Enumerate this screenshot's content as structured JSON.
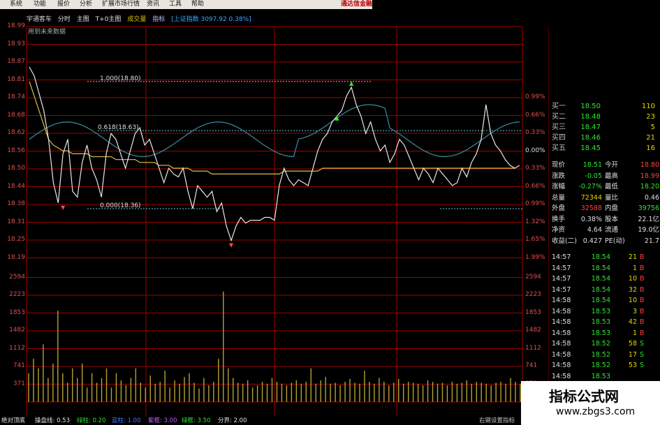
{
  "menu": [
    "系统",
    "功能",
    "报价",
    "分析",
    "扩展市场行情",
    "资讯",
    "工具",
    "帮助"
  ],
  "brand": "通达信金融",
  "header": {
    "name": "宇通客车",
    "tabs": [
      "分时",
      "主图",
      "T+0主图"
    ],
    "volume": "成交量",
    "indicator": "指标",
    "index": "[上证指数 3097.92 0.38%]"
  },
  "future_label": "用到未来数据",
  "price_axis_left": [
    "18.99",
    "18.93",
    "18.87",
    "18.81",
    "18.74",
    "18.68",
    "18.62",
    "18.56",
    "18.50",
    "18.44",
    "18.38",
    "18.31",
    "18.25",
    "18.19"
  ],
  "price_axis_right": [
    "",
    "",
    "",
    "",
    "0.99%",
    "0.66%",
    "0.33%",
    "0.00%",
    "0.33%",
    "0.66%",
    "0.99%",
    "1.32%",
    "1.65%",
    "1.99%"
  ],
  "volume_axis": [
    "2594",
    "2223",
    "1853",
    "1482",
    "1112",
    "741",
    "371"
  ],
  "fib_levels": [
    {
      "label": "1.000(18.80)",
      "price": 18.8
    },
    {
      "label": "0.618(18.63)",
      "price": 18.63
    },
    {
      "label": "0.000(18.36)",
      "price": 18.36
    }
  ],
  "colors": {
    "grid": "#a00000",
    "price_line": "#e8e8e8",
    "avg_line": "#c8b040",
    "index_line": "#3d8ca0",
    "fib_line": "#4fb8c8",
    "volume_bar": "#b8a030"
  },
  "quotes": [
    {
      "label": "买一",
      "price": "18.50",
      "volume": "110"
    },
    {
      "label": "买二",
      "price": "18.48",
      "volume": "23"
    },
    {
      "label": "买三",
      "price": "18.47",
      "volume": "5"
    },
    {
      "label": "买四",
      "price": "18.46",
      "volume": "21"
    },
    {
      "label": "买五",
      "price": "18.45",
      "volume": "16"
    }
  ],
  "stats": [
    {
      "l1": "现价",
      "v1": "18.51",
      "l2": "今开",
      "v2": "18.80"
    },
    {
      "l1": "涨跌",
      "v1": "-0.05",
      "l2": "最高",
      "v2": "18.99"
    },
    {
      "l1": "涨幅",
      "v1": "-0.27%",
      "l2": "最低",
      "v2": "18.20"
    },
    {
      "l1": "总量",
      "v1": "72344",
      "l2": "量比",
      "v2": "0.46"
    },
    {
      "l1": "外盘",
      "v1": "32588",
      "l2": "内盘",
      "v2": "39756"
    },
    {
      "l1": "换手",
      "v1": "0.38%",
      "l2": "股本",
      "v2": "22.1亿"
    },
    {
      "l1": "净资",
      "v1": "4.64",
      "l2": "流通",
      "v2": "19.0亿"
    },
    {
      "l1": "收益(二)",
      "v1": "0.427",
      "l2": "PE(动)",
      "v2": "21.7"
    }
  ],
  "ticks": [
    {
      "time": "14:57",
      "price": "18.54",
      "vol": "21",
      "side": "B"
    },
    {
      "time": "14:57",
      "price": "18.54",
      "vol": "1",
      "side": "B"
    },
    {
      "time": "14:57",
      "price": "18.54",
      "vol": "10",
      "side": "B"
    },
    {
      "time": "14:57",
      "price": "18.54",
      "vol": "32",
      "side": "B"
    },
    {
      "time": "14:58",
      "price": "18.54",
      "vol": "10",
      "side": "B"
    },
    {
      "time": "14:58",
      "price": "18.53",
      "vol": "3",
      "side": "B"
    },
    {
      "time": "14:58",
      "price": "18.53",
      "vol": "42",
      "side": "B"
    },
    {
      "time": "14:58",
      "price": "18.53",
      "vol": "1",
      "side": "B"
    },
    {
      "time": "14:58",
      "price": "18.52",
      "vol": "58",
      "side": "S"
    },
    {
      "time": "14:58",
      "price": "18.52",
      "vol": "17",
      "side": "S"
    },
    {
      "time": "14:58",
      "price": "18.52",
      "vol": "53",
      "side": "S"
    },
    {
      "time": "14:58",
      "price": "18.53",
      "vol": "",
      "side": ""
    }
  ],
  "bottom": {
    "item1": "绝对顶底",
    "item2": "操盘线: 0.53",
    "item3": "绿柱: 0.20",
    "item4": "蓝柱: 1.00",
    "item5": "紫框: 3.00",
    "item6": "绿框: 3.50",
    "item7": "分界: 2.00",
    "right": "右键设置指标"
  },
  "watermark": {
    "title": "指标公式网",
    "url": "www.zbgs3.com"
  },
  "chart_data": {
    "type": "line",
    "title": "",
    "ylabel": "",
    "ylim": [
      18.19,
      18.99
    ],
    "series": [
      {
        "values": [
          18.85,
          18.82,
          18.76,
          18.7,
          18.6,
          18.45,
          18.38,
          18.55,
          18.6,
          18.42,
          18.4,
          18.52,
          18.58,
          18.5,
          18.46,
          18.4,
          18.55,
          18.62,
          18.6,
          18.55,
          18.5,
          18.56,
          18.62,
          18.64,
          18.58,
          18.6,
          18.55,
          18.5,
          18.45,
          18.5,
          18.48,
          18.47,
          18.5,
          18.42,
          18.36,
          18.44,
          18.42,
          18.4,
          18.42,
          18.35,
          18.38,
          18.3,
          18.25,
          18.3,
          18.33,
          18.31,
          18.32,
          18.32,
          18.32,
          18.33,
          18.33,
          18.32,
          18.44,
          18.5,
          18.46,
          18.44,
          18.46,
          18.45,
          18.44,
          18.5,
          18.56,
          18.6,
          18.62,
          18.66,
          18.68,
          18.7,
          18.75,
          18.78,
          18.72,
          18.68,
          18.62,
          18.66,
          18.6,
          18.56,
          18.58,
          18.52,
          18.55,
          18.6,
          18.58,
          18.54,
          18.5,
          18.46,
          18.5,
          18.48,
          18.45,
          18.5,
          18.48,
          18.46,
          18.44,
          18.45,
          18.5,
          18.47,
          18.52,
          18.55,
          18.6,
          18.72,
          18.62,
          18.58,
          18.56,
          18.53,
          18.51,
          18.5,
          18.51
        ]
      },
      {
        "values": [
          18.8,
          18.75,
          18.7,
          18.65,
          18.6,
          18.58,
          18.57,
          18.56,
          18.56,
          18.55,
          18.55,
          18.55,
          18.55,
          18.54,
          18.54,
          18.54,
          18.54,
          18.54,
          18.53,
          18.53,
          18.53,
          18.53,
          18.53,
          18.52,
          18.52,
          18.52,
          18.52,
          18.51,
          18.51,
          18.51,
          18.5,
          18.5,
          18.5,
          18.5,
          18.49,
          18.49,
          18.49,
          18.49,
          18.48,
          18.48,
          18.48,
          18.48,
          18.48,
          18.48,
          18.48,
          18.48,
          18.48,
          18.48,
          18.48,
          18.48,
          18.48,
          18.48,
          18.48,
          18.49,
          18.49,
          18.49,
          18.49,
          18.49,
          18.49,
          18.49,
          18.49,
          18.5,
          18.5,
          18.5,
          18.5,
          18.5,
          18.5,
          18.5,
          18.5,
          18.5,
          18.5,
          18.5,
          18.5,
          18.5,
          18.5,
          18.5,
          18.5,
          18.5,
          18.5,
          18.5,
          18.5,
          18.5,
          18.5,
          18.5,
          18.5,
          18.5,
          18.5,
          18.5,
          18.5,
          18.5,
          18.5,
          18.5,
          18.5,
          18.5,
          18.5,
          18.5,
          18.5,
          18.5,
          18.5,
          18.5,
          18.5,
          18.5
        ]
      }
    ],
    "volume": [
      600,
      900,
      700,
      1200,
      500,
      800,
      1900,
      600,
      400,
      700,
      500,
      800,
      300,
      600,
      400,
      500,
      700,
      300,
      600,
      450,
      350,
      500,
      700,
      400,
      300,
      550,
      380,
      420,
      650,
      300,
      450,
      380,
      520,
      600,
      400,
      280,
      500,
      350,
      420,
      900,
      2300,
      700,
      500,
      400,
      380,
      450,
      300,
      350,
      420,
      380,
      500,
      420,
      380,
      350,
      400,
      450,
      380,
      420,
      700,
      380,
      450,
      520,
      380,
      400,
      350,
      420,
      480,
      400,
      380,
      650,
      420,
      380,
      500,
      420,
      350,
      400,
      480,
      380,
      420,
      400,
      380,
      350,
      450,
      420,
      380,
      400,
      350,
      420,
      380,
      400,
      450,
      380,
      420,
      400,
      380,
      350,
      400,
      420,
      380,
      500,
      420,
      380
    ]
  }
}
